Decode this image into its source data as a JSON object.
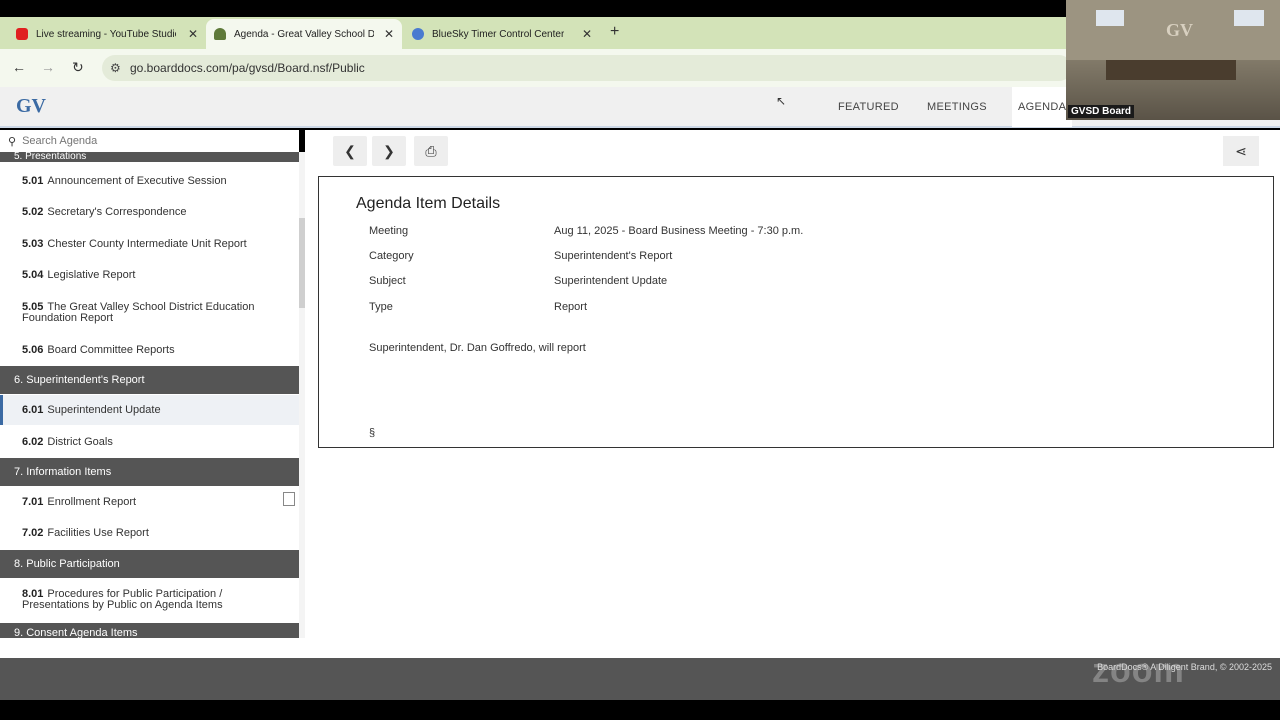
{
  "browser": {
    "tabs": [
      {
        "title": "Live streaming - YouTube Studio",
        "favicon_color": "#e02020"
      },
      {
        "title": "Agenda - Great Valley School District",
        "favicon_color": "#5f7a3a"
      },
      {
        "title": "BlueSky Timer Control Center",
        "favicon_color": "#4a7bd0"
      }
    ],
    "url": "go.boarddocs.com/pa/gvsd/Board.nsf/Public"
  },
  "app": {
    "logo": "GV",
    "nav": [
      "FEATURED",
      "MEETINGS",
      "AGENDA"
    ]
  },
  "video": {
    "label": "GVSD Board",
    "logo": "GV"
  },
  "sidebar": {
    "search_placeholder": "Search Agenda",
    "partial_heading": "5. Presentations",
    "sections": [
      {
        "title": "6. Superintendent's Report"
      },
      {
        "title": "7. Information Items"
      },
      {
        "title": "8. Public Participation"
      },
      {
        "title": "9. Consent Agenda Items"
      }
    ],
    "items": [
      {
        "num": "5.01",
        "label": "Announcement of Executive Session"
      },
      {
        "num": "5.02",
        "label": "Secretary's Correspondence"
      },
      {
        "num": "5.03",
        "label": "Chester County Intermediate Unit Report"
      },
      {
        "num": "5.04",
        "label": "Legislative Report"
      },
      {
        "num": "5.05",
        "label": "The Great Valley School District Education Foundation Report"
      },
      {
        "num": "5.06",
        "label": "Board Committee Reports"
      },
      {
        "num": "6.01",
        "label": "Superintendent Update"
      },
      {
        "num": "6.02",
        "label": "District Goals"
      },
      {
        "num": "7.01",
        "label": "Enrollment Report"
      },
      {
        "num": "7.02",
        "label": "Facilities Use Report"
      },
      {
        "num": "8.01",
        "label": "Procedures for Public Participation / Presentations by Public on Agenda Items"
      }
    ]
  },
  "details": {
    "title": "Agenda Item Details",
    "rows": [
      {
        "key": "Meeting",
        "value": "Aug 11, 2025 - Board Business Meeting - 7:30 p.m."
      },
      {
        "key": "Category",
        "value": "Superintendent's Report"
      },
      {
        "key": "Subject",
        "value": "Superintendent Update"
      },
      {
        "key": "Type",
        "value": "Report"
      }
    ],
    "description": "Superintendent, Dr. Dan Goffredo, will report",
    "section_sign": "§"
  },
  "footer": {
    "copyright": "BoardDocs® A Diligent Brand, © 2002-2025",
    "watermark": "zoom"
  }
}
